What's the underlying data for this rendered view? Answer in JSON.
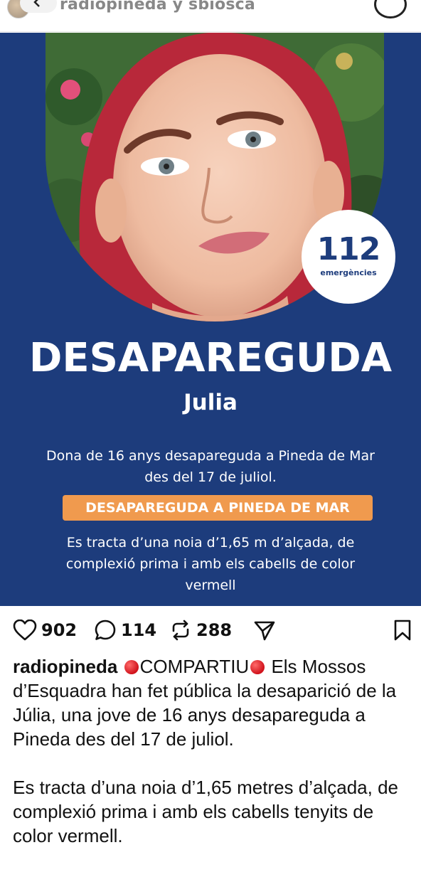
{
  "header": {
    "username": "radiopineda y sbiosca"
  },
  "poster": {
    "badge_number": "112",
    "badge_label": "emergències",
    "title": "DESAPAREGUDA",
    "name": "Julia",
    "description_1": "Dona de 16 anys desapareguda a Pineda de Mar des del 17 de juliol.",
    "banner": "DESAPAREGUDA A PINEDA DE MAR",
    "description_2": "Es tracta d’una noia d’1,65 m d’alçada, de complexió prima i amb els cabells de color vermell"
  },
  "actions": {
    "likes": "902",
    "comments": "114",
    "reposts": "288"
  },
  "caption": {
    "username": "radiopineda",
    "tag": "COMPARTIU",
    "text_1": "Els Mossos d’Esquadra han fet pública la desaparició de la Júlia, una jove de 16 anys desapareguda a Pineda des del 17 de juliol.",
    "text_2": "Es tracta d’una noia d’1,65 metres d’alçada, de complexió prima i amb els cabells tenyits de color vermell."
  },
  "colors": {
    "poster_bg": "#1d3c7c",
    "banner": "#f09a4e",
    "alert_dot": "#d0121b"
  }
}
